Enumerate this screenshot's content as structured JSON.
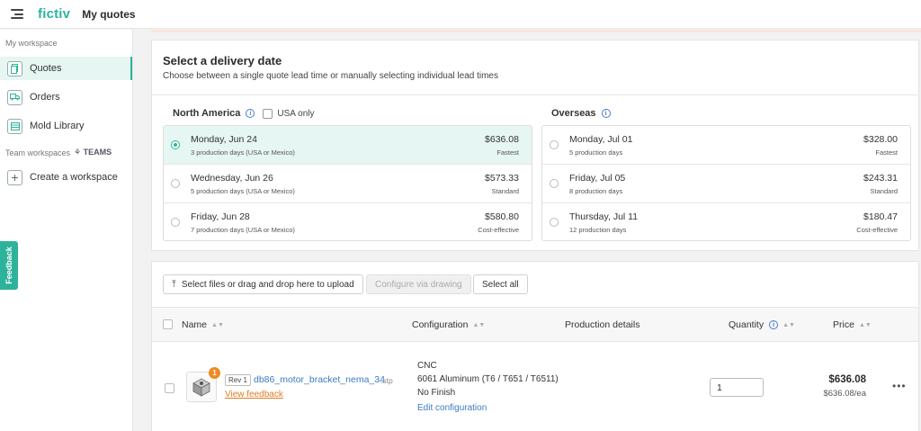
{
  "topbar": {
    "logo": "fictiv",
    "title": "My quotes"
  },
  "sidebar": {
    "workspace_label": "My workspace",
    "items": [
      {
        "label": "Quotes",
        "icon": "document-icon",
        "active": true
      },
      {
        "label": "Orders",
        "icon": "truck-icon",
        "active": false
      },
      {
        "label": "Mold Library",
        "icon": "library-icon",
        "active": false
      }
    ],
    "team_label": "Team workspaces",
    "teams_tag": "TEAMS",
    "create_label": "Create a workspace",
    "feedback_label": "Feedback"
  },
  "delivery": {
    "title": "Select a delivery date",
    "subtitle": "Choose between a single quote lead time or manually selecting individual lead times",
    "north_america": {
      "label": "North America",
      "usa_only_label": "USA only",
      "options": [
        {
          "date": "Monday, Jun 24",
          "days": "3 production days (USA or Mexico)",
          "price": "$636.08",
          "tag": "Fastest",
          "selected": true
        },
        {
          "date": "Wednesday, Jun 26",
          "days": "5 production days (USA or Mexico)",
          "price": "$573.33",
          "tag": "Standard",
          "selected": false
        },
        {
          "date": "Friday, Jun 28",
          "days": "7 production days (USA or Mexico)",
          "price": "$580.80",
          "tag": "Cost-effective",
          "selected": false
        }
      ]
    },
    "overseas": {
      "label": "Overseas",
      "options": [
        {
          "date": "Monday, Jul 01",
          "days": "5 production days",
          "price": "$328.00",
          "tag": "Fastest",
          "selected": false
        },
        {
          "date": "Friday, Jul 05",
          "days": "8 production days",
          "price": "$243.31",
          "tag": "Standard",
          "selected": false
        },
        {
          "date": "Thursday, Jul 11",
          "days": "12 production days",
          "price": "$180.47",
          "tag": "Cost-effective",
          "selected": false
        }
      ]
    }
  },
  "parts": {
    "upload_label": "Select files or drag and drop here to upload",
    "configure_label": "Configure via drawing",
    "select_all_label": "Select all",
    "columns": {
      "name": "Name",
      "configuration": "Configuration",
      "production": "Production details",
      "quantity": "Quantity",
      "price": "Price"
    },
    "row": {
      "badge": "1",
      "rev": "Rev 1",
      "filename": "db86_motor_bracket_nema_34",
      "ext": ".stp",
      "view_feedback": "View feedback",
      "process": "CNC",
      "material": "6061 Aluminum (T6 / T651 / T6511)",
      "finish": "No Finish",
      "edit_config": "Edit configuration",
      "quantity": "1",
      "price": "$636.08",
      "price_each": "$636.08/ea"
    }
  },
  "colors": {
    "brand": "#2db39b",
    "link": "#3d7ac4",
    "warning": "#f08a24"
  }
}
